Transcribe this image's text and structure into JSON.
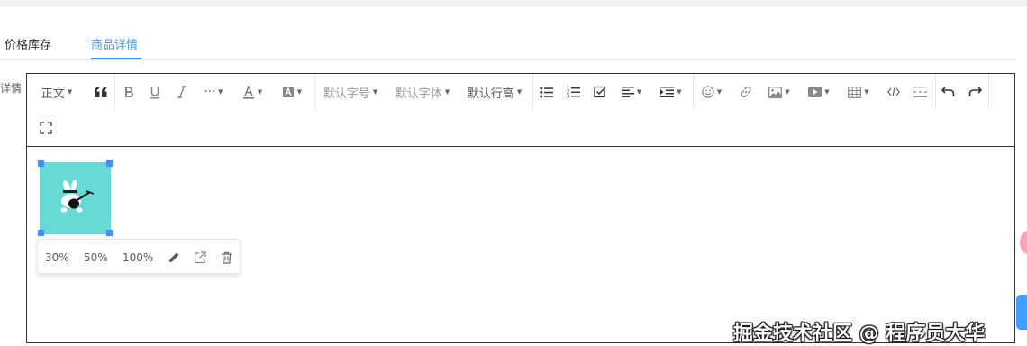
{
  "tabs": [
    {
      "label": "价格库存",
      "active": false
    },
    {
      "label": "商品详情",
      "active": true
    }
  ],
  "side_label": "详情",
  "toolbar": {
    "heading": "正文",
    "font_size": "默认字号",
    "font_family": "默认字体",
    "line_height": "默认行高",
    "more": "···",
    "icons": [
      "quote-icon",
      "bold-icon",
      "underline-icon",
      "italic-icon",
      "more-icon",
      "font-color-icon",
      "background-color-icon",
      "bulleted-list-icon",
      "numbered-list-icon",
      "todo-icon",
      "align-icon",
      "indent-icon",
      "emotion-icon",
      "link-icon",
      "image-icon",
      "video-icon",
      "table-icon",
      "code-icon",
      "divider-icon",
      "undo-icon",
      "redo-icon",
      "fullscreen-icon"
    ]
  },
  "image_popover": {
    "sizes": [
      "30%",
      "50%",
      "100%"
    ],
    "icons": [
      "edit-icon",
      "open-link-icon",
      "delete-icon"
    ]
  },
  "watermark": "掘金技术社区 @ 程序员大华",
  "colors": {
    "accent": "#409eff",
    "image_bg": "#67dad6",
    "handle": "#4290f7"
  }
}
